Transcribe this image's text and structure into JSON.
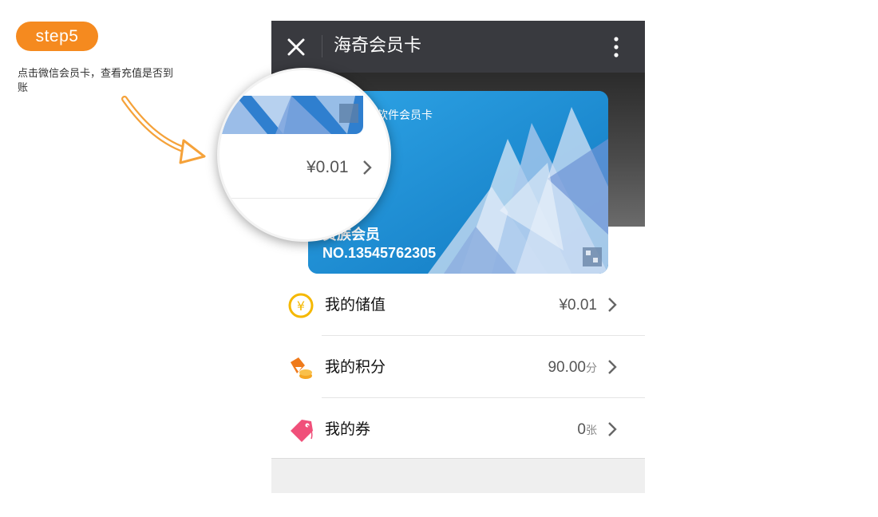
{
  "step": {
    "badge": "step5",
    "instruction": "点击微信会员卡，查看充值是否到账"
  },
  "titlebar": {
    "title": "海奇会员卡",
    "close_icon": "close-icon",
    "more_icon": "more-vertical-icon"
  },
  "card": {
    "brand": "软件会员卡",
    "level": "贵族会员",
    "number": "NO.13545762305"
  },
  "list": [
    {
      "label": "我的储值",
      "value": "¥0.01",
      "unit": "",
      "icon": "yuan-coin-icon",
      "color": "#f5b800"
    },
    {
      "label": "我的积分",
      "value": "90.00",
      "unit": "分",
      "icon": "points-coin-icon",
      "color": "#ef7a1a"
    },
    {
      "label": "我的券",
      "value": "0",
      "unit": "张",
      "icon": "coupon-tag-icon",
      "color": "#f0507a"
    }
  ],
  "magnifier": {
    "value": "¥0.01"
  },
  "colors": {
    "accent": "#f58a1f",
    "titlebar": "#393a3f",
    "card": "#1e8fd6"
  }
}
